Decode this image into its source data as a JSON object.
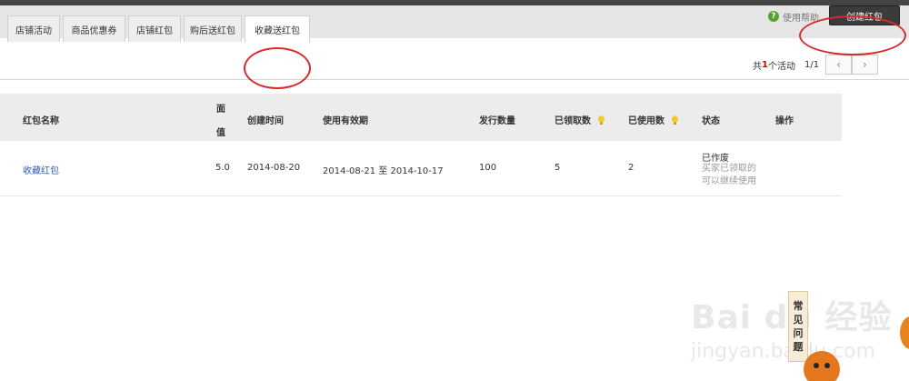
{
  "header": {
    "help_label": "使用帮助",
    "create_button": "创建红包"
  },
  "tabs": [
    {
      "label": "店铺活动"
    },
    {
      "label": "商品优惠券"
    },
    {
      "label": "店铺红包"
    },
    {
      "label": "购后送红包"
    },
    {
      "label": "收藏送红包"
    }
  ],
  "pager": {
    "prefix": "共",
    "count": "1",
    "suffix": "个活动",
    "page": "1/1",
    "prev": "‹",
    "next": "›"
  },
  "table": {
    "headers": {
      "name": "红包名称",
      "value_line1": "面",
      "value_line2": "值",
      "created": "创建时间",
      "validity": "使用有效期",
      "issued": "发行数量",
      "received": "已领取数",
      "used": "已使用数",
      "status": "状态",
      "actions": "操作"
    },
    "rows": [
      {
        "name": "收藏红包",
        "value": "5.0",
        "created": "2014-08-20",
        "validity": "2014-08-21 至 2014-10-17",
        "issued": "100",
        "received": "5",
        "used": "2",
        "status": "已作废",
        "status_note_1": "买家已领取的",
        "status_note_2": "可以继续使用"
      }
    ]
  },
  "faq": {
    "c1": "常",
    "c2": "见",
    "c3": "问",
    "c4": "题"
  },
  "watermark": {
    "main": "Bai du 经验",
    "sub": "jingyan.baidu.com"
  },
  "colors": {
    "annotation_red": "#d42c2c",
    "link_blue": "#2a5db0",
    "button_dark": "#3b3b3b"
  }
}
